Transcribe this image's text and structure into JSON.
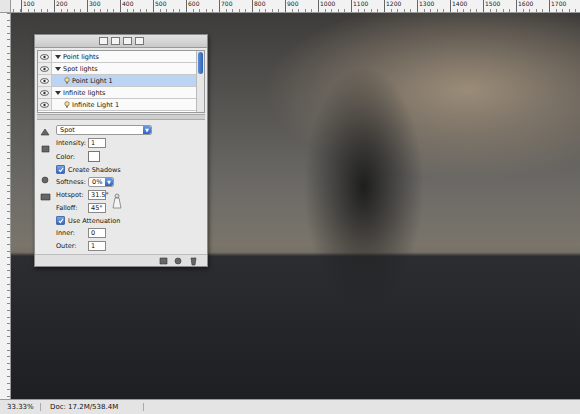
{
  "ruler": {
    "labels": [
      "100",
      "200",
      "300",
      "400",
      "500",
      "600",
      "700",
      "800",
      "900",
      "1000",
      "1100",
      "1200",
      "1300",
      "1400",
      "1500",
      "1600",
      "1700"
    ]
  },
  "lights_panel": {
    "lights": [
      {
        "label": "Point lights",
        "kind": "group",
        "expanded": true,
        "visible": true,
        "selected": false
      },
      {
        "label": "Spot lights",
        "kind": "group",
        "expanded": true,
        "visible": true,
        "selected": false
      },
      {
        "label": "Point Light 1",
        "kind": "light",
        "expanded": false,
        "visible": true,
        "selected": true
      },
      {
        "label": "Infinite lights",
        "kind": "group",
        "expanded": true,
        "visible": true,
        "selected": false
      },
      {
        "label": "Infinite Light 1",
        "kind": "light",
        "expanded": false,
        "visible": true,
        "selected": false
      }
    ],
    "type": "Spot",
    "intensity": {
      "label": "Intensity:",
      "value": "1"
    },
    "color": {
      "label": "Color:",
      "value": "#ffffff"
    },
    "create_shadows": {
      "label": "Create Shadows",
      "checked": true
    },
    "softness": {
      "label": "Softness:",
      "value": "0%"
    },
    "hotspot": {
      "label": "Hotspot:",
      "value": "31.5°"
    },
    "falloff": {
      "label": "Falloff:",
      "value": "45°"
    },
    "use_attenuation": {
      "label": "Use Attenuation",
      "checked": true
    },
    "inner": {
      "label": "Inner:",
      "value": "0"
    },
    "outer": {
      "label": "Outer:",
      "value": "1"
    }
  },
  "status_bar": {
    "zoom": "33.33%",
    "doc": "Doc: 17.2M/538.4M"
  }
}
